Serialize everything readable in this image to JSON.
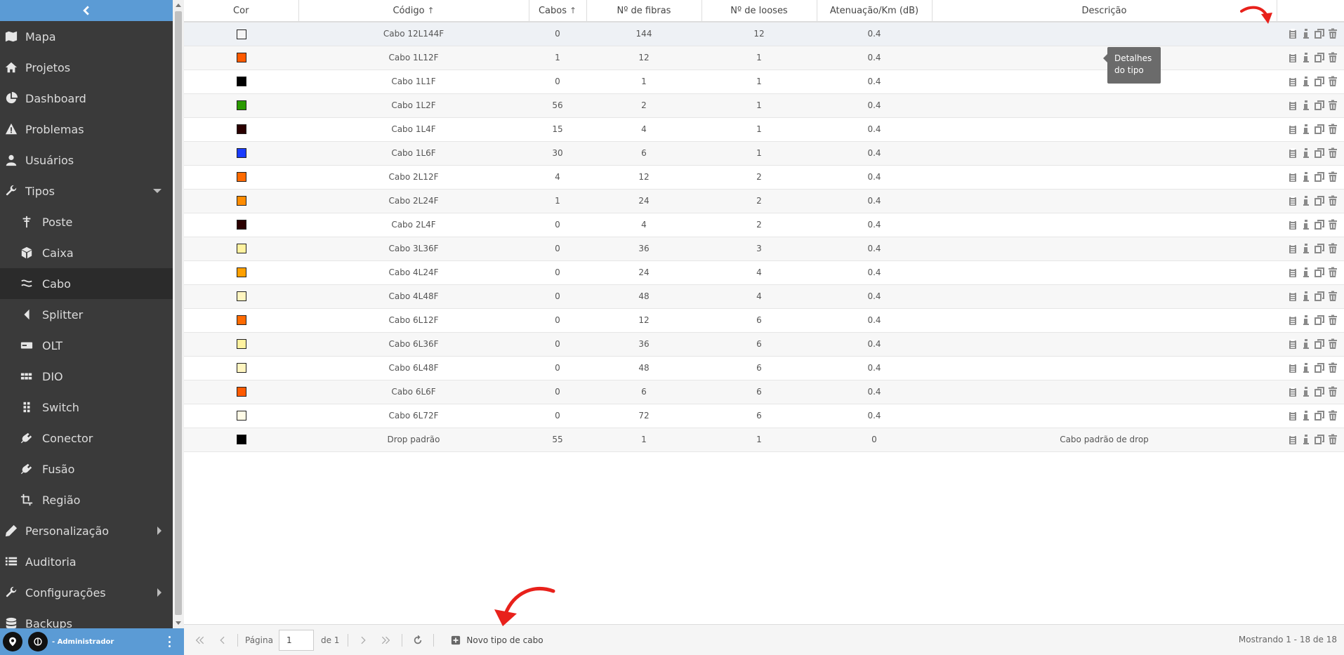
{
  "sidebar": {
    "items": [
      {
        "label": "Mapa",
        "icon": "map-icon"
      },
      {
        "label": "Projetos",
        "icon": "home-icon"
      },
      {
        "label": "Dashboard",
        "icon": "pie-chart-icon"
      },
      {
        "label": "Problemas",
        "icon": "warning-icon"
      },
      {
        "label": "Usuários",
        "icon": "user-icon"
      },
      {
        "label": "Tipos",
        "icon": "wrench-icon"
      },
      {
        "label": "Poste",
        "icon": "pole-icon"
      },
      {
        "label": "Caixa",
        "icon": "box-icon"
      },
      {
        "label": "Cabo",
        "icon": "cable-icon"
      },
      {
        "label": "Splitter",
        "icon": "splitter-icon"
      },
      {
        "label": "OLT",
        "icon": "olt-icon"
      },
      {
        "label": "DIO",
        "icon": "dio-icon"
      },
      {
        "label": "Switch",
        "icon": "switch-icon"
      },
      {
        "label": "Conector",
        "icon": "plug-icon"
      },
      {
        "label": "Fusão",
        "icon": "plug-icon"
      },
      {
        "label": "Região",
        "icon": "crop-icon"
      },
      {
        "label": "Personalização",
        "icon": "pencil-icon"
      },
      {
        "label": "Auditoria",
        "icon": "list-icon"
      },
      {
        "label": "Configurações",
        "icon": "wrench-icon"
      },
      {
        "label": "Backups",
        "icon": "database-icon"
      }
    ]
  },
  "user": {
    "name": "- Administrador"
  },
  "table": {
    "headers": [
      "Cor",
      "Código",
      "Cabos",
      "Nº de fibras",
      "Nº de looses",
      "Atenuação/Km (dB)",
      "Descrição",
      ""
    ],
    "rows": [
      {
        "color": "#f5f5f5",
        "code": "Cabo 12L144F",
        "cables": "0",
        "fibers": "144",
        "looses": "12",
        "att": "0.4",
        "desc": ""
      },
      {
        "color": "#ff5a00",
        "code": "Cabo 1L12F",
        "cables": "1",
        "fibers": "12",
        "looses": "1",
        "att": "0.4",
        "desc": ""
      },
      {
        "color": "#000000",
        "code": "Cabo 1L1F",
        "cables": "0",
        "fibers": "1",
        "looses": "1",
        "att": "0.4",
        "desc": ""
      },
      {
        "color": "#2a9a00",
        "code": "Cabo 1L2F",
        "cables": "56",
        "fibers": "2",
        "looses": "1",
        "att": "0.4",
        "desc": ""
      },
      {
        "color": "#2a0000",
        "code": "Cabo 1L4F",
        "cables": "15",
        "fibers": "4",
        "looses": "1",
        "att": "0.4",
        "desc": ""
      },
      {
        "color": "#1a3cff",
        "code": "Cabo 1L6F",
        "cables": "30",
        "fibers": "6",
        "looses": "1",
        "att": "0.4",
        "desc": ""
      },
      {
        "color": "#ff6a00",
        "code": "Cabo 2L12F",
        "cables": "4",
        "fibers": "12",
        "looses": "2",
        "att": "0.4",
        "desc": ""
      },
      {
        "color": "#ff8c00",
        "code": "Cabo 2L24F",
        "cables": "1",
        "fibers": "24",
        "looses": "2",
        "att": "0.4",
        "desc": ""
      },
      {
        "color": "#2a0000",
        "code": "Cabo 2L4F",
        "cables": "0",
        "fibers": "4",
        "looses": "2",
        "att": "0.4",
        "desc": ""
      },
      {
        "color": "#fff2a0",
        "code": "Cabo 3L36F",
        "cables": "0",
        "fibers": "36",
        "looses": "3",
        "att": "0.4",
        "desc": ""
      },
      {
        "color": "#ffa000",
        "code": "Cabo 4L24F",
        "cables": "0",
        "fibers": "24",
        "looses": "4",
        "att": "0.4",
        "desc": ""
      },
      {
        "color": "#fff5c0",
        "code": "Cabo 4L48F",
        "cables": "0",
        "fibers": "48",
        "looses": "4",
        "att": "0.4",
        "desc": ""
      },
      {
        "color": "#ff6a00",
        "code": "Cabo 6L12F",
        "cables": "0",
        "fibers": "12",
        "looses": "6",
        "att": "0.4",
        "desc": ""
      },
      {
        "color": "#fff2a0",
        "code": "Cabo 6L36F",
        "cables": "0",
        "fibers": "36",
        "looses": "6",
        "att": "0.4",
        "desc": ""
      },
      {
        "color": "#fff5c0",
        "code": "Cabo 6L48F",
        "cables": "0",
        "fibers": "48",
        "looses": "6",
        "att": "0.4",
        "desc": ""
      },
      {
        "color": "#ff5a00",
        "code": "Cabo 6L6F",
        "cables": "0",
        "fibers": "6",
        "looses": "6",
        "att": "0.4",
        "desc": ""
      },
      {
        "color": "#fffbe6",
        "code": "Cabo 6L72F",
        "cables": "0",
        "fibers": "72",
        "looses": "6",
        "att": "0.4",
        "desc": ""
      },
      {
        "color": "#000000",
        "code": "Drop padrão",
        "cables": "55",
        "fibers": "1",
        "looses": "1",
        "att": "0",
        "desc": "Cabo padrão de drop"
      }
    ]
  },
  "tooltip": {
    "line1": "Detalhes",
    "line2": "do tipo"
  },
  "footer": {
    "page_label": "Página",
    "page_value": "1",
    "of_label": "de 1",
    "add_label": "Novo tipo de cabo",
    "status": "Mostrando 1 - 18 de 18"
  },
  "colors": {
    "sidebar": "#3a3a3a",
    "accent": "#5b9bd5",
    "annotation": "#e8211b"
  }
}
